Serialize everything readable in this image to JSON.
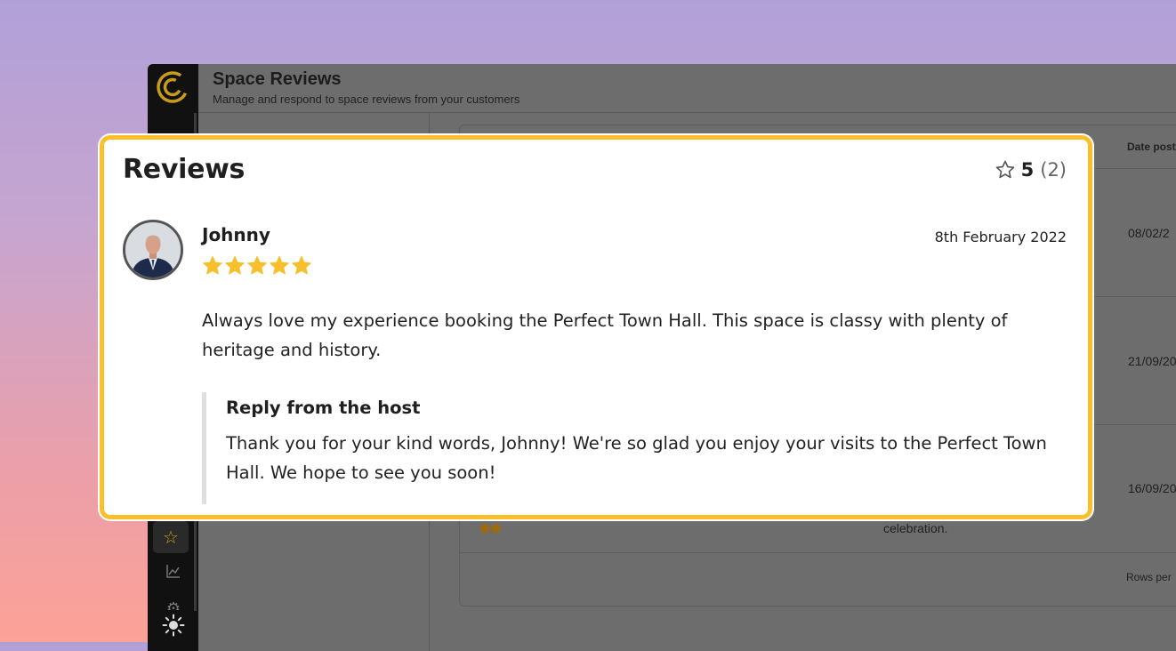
{
  "app": {
    "title": "Space Reviews",
    "subtitle": "Manage and respond to space reviews from your customers",
    "table": {
      "date_header": "Date post",
      "rows": [
        {
          "date": "08/02/2"
        },
        {
          "date": "21/09/20"
        },
        {
          "date": "16/09/20"
        }
      ],
      "row3_text": "celebration.",
      "rows_per_page_label": "Rows per"
    },
    "sidebar_icons": [
      "star-icon",
      "chart-icon",
      "settings-icon",
      "sun-icon"
    ]
  },
  "review_card": {
    "title": "Reviews",
    "average": "5",
    "count": "(2)",
    "review": {
      "reviewer": "Johnny",
      "date": "8th February 2022",
      "stars": 5,
      "body": "Always love my experience booking the Perfect Town Hall. This space is classy with plenty of heritage and history.",
      "reply_title": "Reply from the host",
      "reply_body": "Thank you for your kind words, Johnny! We're so glad you enjoy your visits to the Perfect Town Hall. We hope to see you soon!"
    }
  },
  "colors": {
    "accent": "#fbbf2b",
    "star": "#f8bf2c",
    "logo": "#c99b1c"
  }
}
